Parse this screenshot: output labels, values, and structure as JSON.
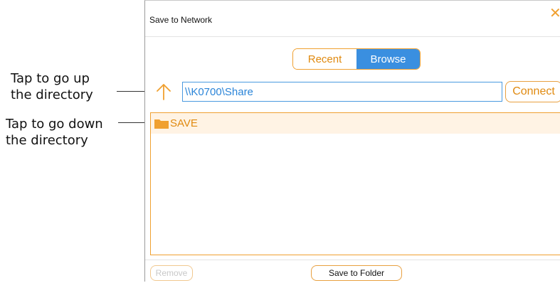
{
  "annotations": {
    "up": [
      "Tap to go up",
      "the directory"
    ],
    "down": [
      "Tap to go down",
      "the directory"
    ]
  },
  "dialog": {
    "title": "Save to Network",
    "close_glyph": "✕",
    "tabs": [
      {
        "label": "Recent",
        "selected": false
      },
      {
        "label": "Browse",
        "selected": true
      }
    ],
    "path": {
      "value": "\\\\K0700\\Share"
    },
    "connect_label": "Connect",
    "items": [
      {
        "label": "SAVE",
        "icon": "folder-icon"
      }
    ],
    "remove_label": "Remove",
    "save_folder_label": "Save to Folder"
  },
  "colors": {
    "accent": "#f0a030",
    "selected_tab": "#3a8fe0",
    "path_text": "#2a84d8"
  }
}
